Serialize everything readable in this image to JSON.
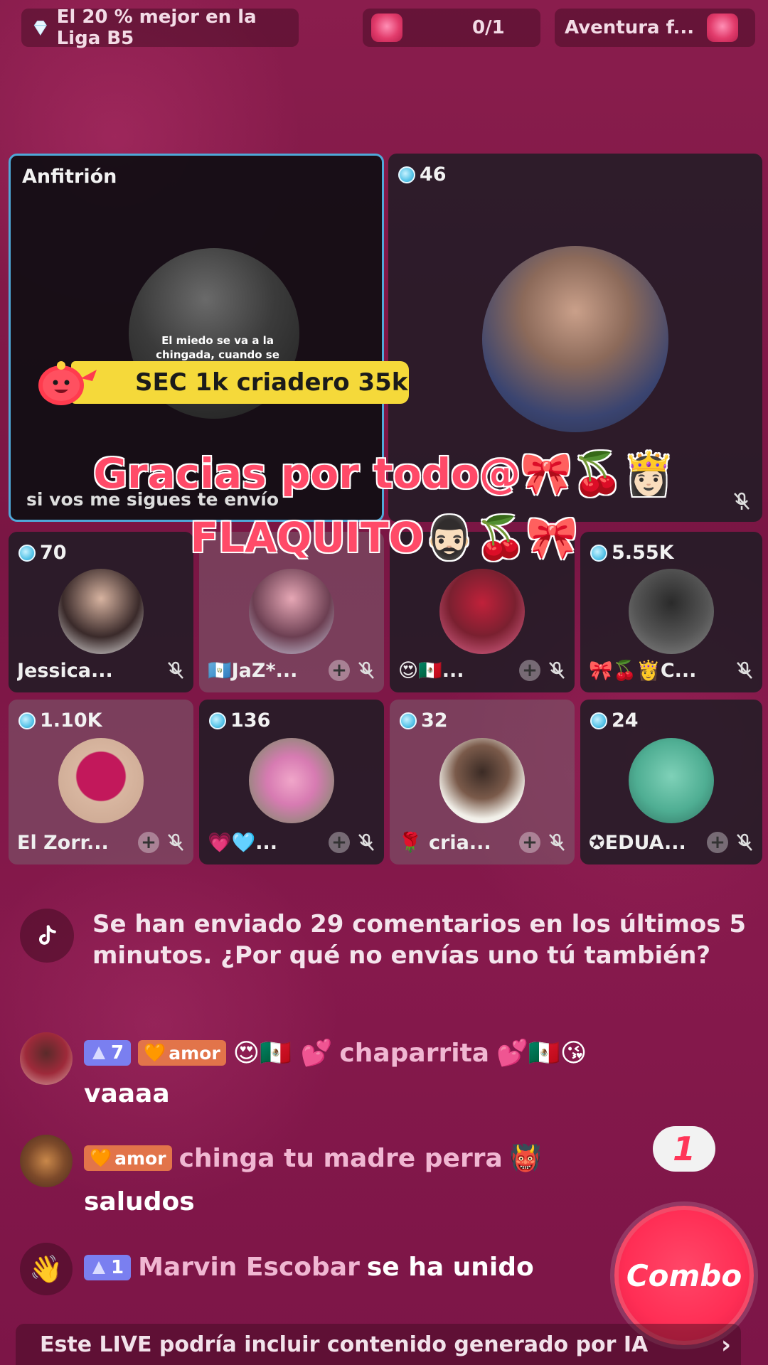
{
  "top_bar": {
    "league_text": "El 20 % mejor en la Liga B5",
    "progress_text": "0/1",
    "adventure_text": "Aventura f..."
  },
  "host_seat": {
    "label": "Anfitrión",
    "video_caption": "El miedo se va a la chingada, cuando se trata de...",
    "bottom_text": "si vos me sigues te envío"
  },
  "goal_banner": {
    "text": "SEC 1k criadero 35k"
  },
  "overlay_caption": {
    "line1": "Gracias por todo@🎀🍒👸🏻",
    "line2": "FLAQUITO🧔🏻‍♂️🍒🎀"
  },
  "seats": [
    {
      "id": "s1",
      "coins": "46",
      "name": ""
    },
    {
      "id": "s2",
      "coins": "70",
      "name": "Jessica..."
    },
    {
      "id": "s3",
      "coins": "",
      "name": "🇬🇹JaZ*..."
    },
    {
      "id": "s4",
      "coins": "",
      "name": "😍🇲🇽..."
    },
    {
      "id": "s5",
      "coins": "5.55K",
      "name": "🎀🍒👸C..."
    },
    {
      "id": "s6",
      "coins": "1.10K",
      "name": "El Zorr..."
    },
    {
      "id": "s7",
      "coins": "136",
      "name": "💗🩵..."
    },
    {
      "id": "s8",
      "coins": "32",
      "name": "🌹 cria..."
    },
    {
      "id": "s9",
      "coins": "24",
      "name": "✪EDUA..."
    }
  ],
  "chat": {
    "system_message": "Se han enviado 29 comentarios en los últimos 5 minutos. ¿Por qué no envías uno tú también?",
    "messages": [
      {
        "level": "7",
        "badge": "amor",
        "user_prefix": "😍🇲🇽 💕",
        "username": "chaparrita",
        "user_suffix": "💕🇲🇽😘",
        "text": "vaaaa"
      },
      {
        "badge": "amor",
        "username": "chinga tu madre perra",
        "user_suffix": "👹",
        "text": "saludos"
      }
    ],
    "join_event": {
      "level": "1",
      "username": "Marvin Escobar",
      "action": "se ha unido"
    }
  },
  "combo": {
    "count": "1",
    "label": "Combo"
  },
  "ai_notice": "Este LIVE podría incluir contenido generado por IA",
  "colors": {
    "background": "#7a1644",
    "host_border": "#4fa9d9",
    "goal_yellow": "#f5d93a",
    "combo_red": "#ff2e55",
    "caption_red": "#ff4a68",
    "level_badge": "#7a7ff0",
    "amor_badge": "#e2744a"
  }
}
